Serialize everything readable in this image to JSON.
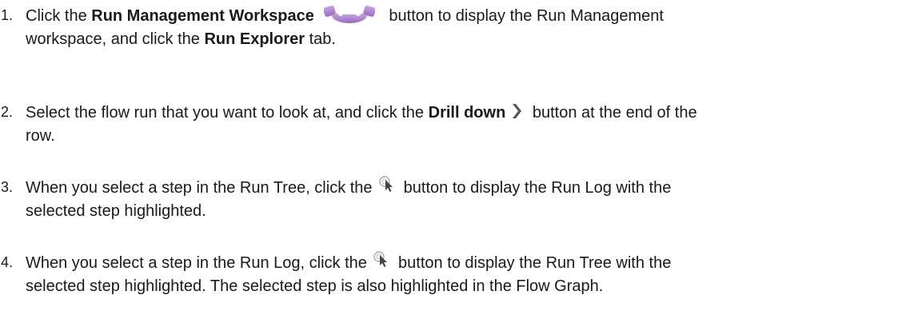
{
  "steps": [
    {
      "num": "1.",
      "a": "Click the ",
      "b1": "Run Management Workspace",
      "c": " button to display the Run Management",
      "d": "workspace, and click the ",
      "b2": "Run Explorer",
      "e": " tab."
    },
    {
      "num": "2.",
      "a": "Select the flow run that you want to look at, and click the ",
      "b1": "Drill down",
      "c": " button at the end of the",
      "d": "row."
    },
    {
      "num": "3.",
      "a": "When you select a step in the Run Tree, click the ",
      "c": " button to display the Run Log with the",
      "d": "selected step highlighted."
    },
    {
      "num": "4.",
      "a": "When you select a step in the Run Log, click the ",
      "c": " button to display the Run Tree with the",
      "d": "selected step highlighted. The selected step is also highlighted in the Flow Graph."
    }
  ],
  "icons": {
    "gear": "run-management-workspace-gear-icon",
    "chevron": "drill-down-chevron-icon",
    "cursor": "highlight-cursor-icon"
  },
  "colors": {
    "gear": "#a77fc8",
    "chevron": "#555555",
    "cursor": "#444444"
  }
}
